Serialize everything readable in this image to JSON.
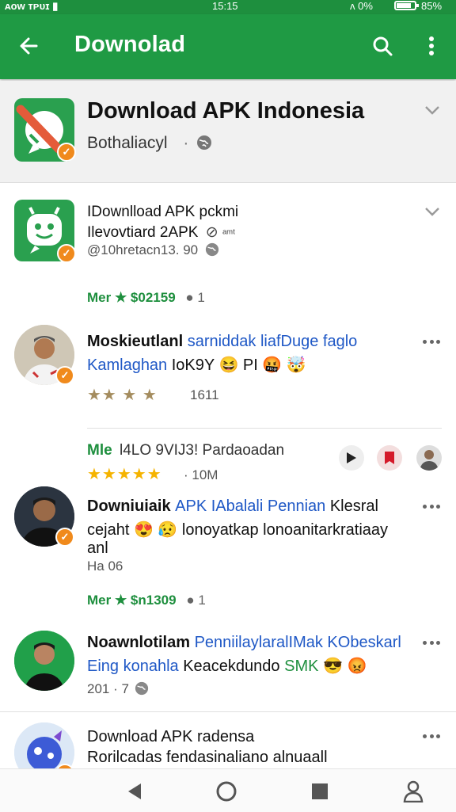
{
  "status_bar": {
    "left": "ᴀᴏᴡ ᴛᴘᴜɪ ▮",
    "time": "15:15",
    "right": "ᴧ 0%",
    "battery": "85%"
  },
  "app_bar": {
    "title": "Downolad"
  },
  "header": {
    "title": "Download APK Indonesia",
    "subtitle": "Bothaliacyl",
    "subtitle_sep": "·"
  },
  "posts": [
    {
      "title": "IDownlload APK pckmi",
      "line2": "Ilevovtiard 2APK",
      "line2_extra": "ᵃᵐᵗ",
      "meta": "@10hretacn13.  90",
      "price": "Mer ★ $02159",
      "price_count": "1"
    },
    {
      "name": "Moskieutlanl",
      "name_blue": "sarniddak liafDuge faglo",
      "line2_blue": "Kamlaghan",
      "line2": "IoK9Y",
      "line2_extra": "PI",
      "rating_count": "1611"
    },
    {
      "label": "Mle",
      "text": "l4LO 9VIJ3! Pardaoadan",
      "rating_count": "· 10M"
    },
    {
      "name": "Downiuiaik",
      "name_blue": "APK IAbalali Pennian",
      "name_tail": "Klesral",
      "line2": "cejaht",
      "line2_rest": "lonoyatkap lonoanitarkratiaay",
      "line3": "anl",
      "meta": "Ha 06",
      "price": "Mer ★ $n1309",
      "price_count": "1"
    },
    {
      "name": "Noawnlotilam",
      "name_blue": "PenniilaylaralIMak KObeskarl",
      "line2_blue": "Eing konahla",
      "line2": "Keacekdundo",
      "line2_green": "SMK",
      "meta": "201 · 7"
    },
    {
      "name": "Download APK radensa",
      "line2": "Rorilcadas fendasinaliano alnuaall"
    }
  ],
  "icons": [
    "back-arrow-icon",
    "search-icon",
    "more-vert-icon",
    "chevron-down-icon",
    "globe-icon",
    "play-icon",
    "bookmark-icon",
    "nav-back-icon",
    "nav-home-icon",
    "nav-recents-icon",
    "nav-profile-icon"
  ],
  "colors": {
    "app_bar": "#1f9a44",
    "accent_orange": "#f08a1c",
    "link_blue": "#1f58c6",
    "price_green": "#1e8f3e"
  }
}
